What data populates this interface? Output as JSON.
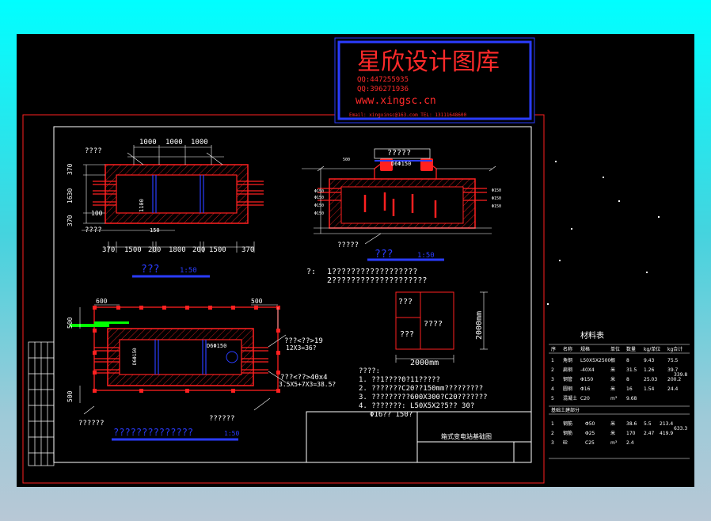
{
  "watermark": {
    "title": "星欣设计图库",
    "qq1": "QQ:447255935",
    "qq2": "QQ:396271936",
    "site": "www.xingsc.cn",
    "contact": "Email: xingxinsc@163.com  TEL: 13111648600"
  },
  "plan_top": {
    "label_left": "????",
    "dims_top": [
      "1000",
      "1000",
      "1000"
    ],
    "dims_left": [
      "370",
      "1630",
      "370"
    ],
    "dim_inner": "100",
    "dim_mid": "1100",
    "dim_bottom_small": "150",
    "label_bottom": "????",
    "dims_bottom": [
      "370",
      "1500",
      "200",
      "1800",
      "200",
      "1500",
      "370"
    ],
    "caption": "???",
    "caption_scale": "1:50"
  },
  "section": {
    "label_top": "?????",
    "pipe": "D6Φ150",
    "label_bottom": "?????",
    "caption": "???",
    "caption_scale": "1:50",
    "left_dims": [
      "500",
      "Φ150",
      "Φ150",
      "Φ150",
      "Φ150"
    ],
    "right_dims": [
      "Φ150",
      "Φ150",
      "Φ150"
    ]
  },
  "notes": {
    "prefix": "?:",
    "line1": "1??????????????????",
    "line2": "2????????????????????"
  },
  "plan_bottom": {
    "dim_600": "600",
    "dim_500_right": "500",
    "dim_500_left": "500",
    "dim_500_bottom": "500",
    "pipe_left": "D6Φ150",
    "pipe_right": "D6Φ150",
    "callout1": "???<??>19",
    "callout1b": "12X3=36?",
    "callout2": "???<??>40x4",
    "callout2b": "3.5X5+7X3=38.5?",
    "label_left": "??????",
    "label_right": "??????",
    "caption": "??????????????",
    "caption_scale": "1:50"
  },
  "detail_box": {
    "cells": [
      "???",
      "????",
      "???"
    ],
    "dim_h": "2000mm",
    "dim_v": "2000mm"
  },
  "spec_notes": {
    "heading": "????:",
    "l1": "1. ??1????0?11?????",
    "l2": "2. ???????C20??150mm?????????",
    "l3": "3. ?????????600X300?C20???????",
    "l4": "4. ???????: L50X5X2?5?? 30?",
    "l5": "Φ16?? 150?"
  },
  "title_block": {
    "drawing_title": "箱式变电站基础图"
  },
  "material_table": {
    "title": "材料表",
    "head": [
      "序",
      "名称",
      "规格",
      "单位",
      "数量",
      "kg/单位",
      "kg合计"
    ],
    "rows": [
      [
        "1",
        "角钢",
        "L50X5X2500",
        "根",
        "8",
        "9.43",
        "75.5"
      ],
      [
        "2",
        "扁钢",
        "-40X4",
        "米",
        "31.5",
        "1.26",
        "39.7"
      ],
      [
        "3",
        "钢管",
        "Φ150",
        "米",
        "8",
        "25.03",
        "200.2"
      ],
      [
        "4",
        "圆钢",
        "Φ16",
        "米",
        "16",
        "1.54",
        "24.4"
      ],
      [
        "5",
        "混凝土",
        "C20",
        "m³",
        "9.68",
        "",
        ""
      ]
    ],
    "total1": "339.8",
    "sub_head": "基础土建部分",
    "rows2": [
      [
        "1",
        "钢筋",
        "Φ50",
        "米",
        "38.6",
        "5.5",
        "213.4"
      ],
      [
        "2",
        "钢筋",
        "Φ25",
        "米",
        "170",
        "2.47",
        "419.9"
      ],
      [
        "3",
        "砼",
        "C25",
        "m³",
        "2.4",
        "",
        ""
      ]
    ],
    "total2": "633.3"
  },
  "colors": {
    "red": "#ff2020",
    "blue": "#2a3cff",
    "white": "#ffffff",
    "green": "#00ff00",
    "watermark": "#ff2a2a"
  }
}
